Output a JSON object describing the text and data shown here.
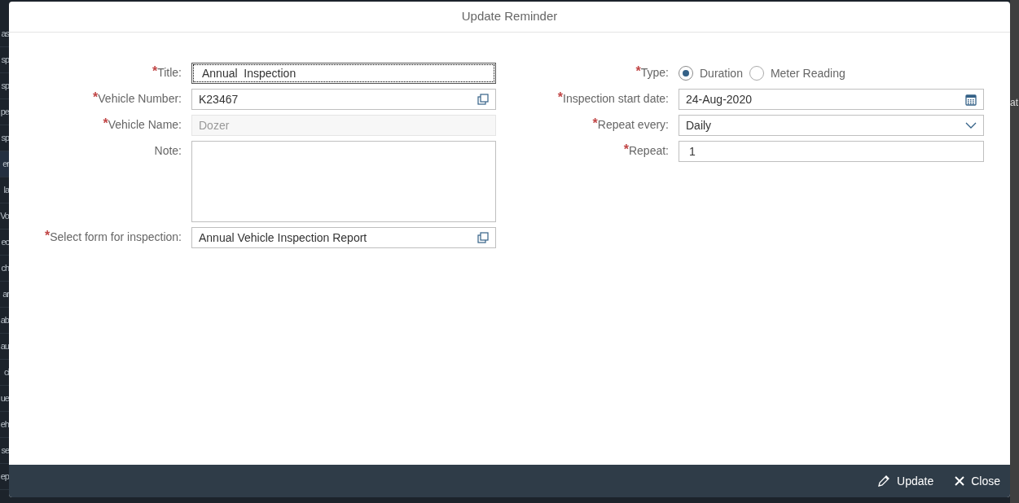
{
  "background": {
    "sidebar_items": [
      {
        "label": "as",
        "selected": false
      },
      {
        "label": "sp",
        "selected": false
      },
      {
        "label": "sp",
        "selected": false
      },
      {
        "label": "pe",
        "selected": false
      },
      {
        "label": "sp",
        "selected": false
      },
      {
        "label": "er",
        "selected": true
      },
      {
        "label": "la",
        "selected": false
      },
      {
        "label": "Vo",
        "selected": false
      },
      {
        "label": "ec",
        "selected": false
      },
      {
        "label": "ch",
        "selected": false
      },
      {
        "label": "ar",
        "selected": false
      },
      {
        "label": "ab",
        "selected": false
      },
      {
        "label": "au",
        "selected": false
      },
      {
        "label": "ci",
        "selected": false
      },
      {
        "label": "ue",
        "selected": false
      },
      {
        "label": "eh",
        "selected": false
      },
      {
        "label": "se",
        "selected": false
      },
      {
        "label": "ep",
        "selected": false
      }
    ],
    "right_fragment": "at"
  },
  "dialog": {
    "title": "Update Reminder",
    "left_fields": [
      {
        "kind": "text",
        "required_mark": "*",
        "label": "Title:",
        "value": "Annual  Inspection",
        "focused": true
      },
      {
        "kind": "value_help",
        "required_mark": "*",
        "label": "Vehicle Number:",
        "value": "K23467"
      },
      {
        "kind": "disabled",
        "required_mark": "*",
        "label": "Vehicle Name:",
        "value": "Dozer"
      },
      {
        "kind": "textarea",
        "label": "Note:"
      },
      {
        "kind": "value_help",
        "required_mark": "*",
        "label": "Select form for inspection:",
        "value": "Annual Vehicle Inspection Report"
      }
    ],
    "right_fields": [
      {
        "kind": "radio",
        "required_mark": "*",
        "label": "Type:",
        "options": [
          {
            "label": "Duration",
            "selected": true
          },
          {
            "label": "Meter Reading",
            "selected": false
          }
        ]
      },
      {
        "kind": "date",
        "required_mark": "*",
        "label": "Inspection start date:",
        "value": "24-Aug-2020"
      },
      {
        "kind": "select",
        "required_mark": "*",
        "label": "Repeat every:",
        "value": "Daily"
      },
      {
        "kind": "text",
        "required_mark": "*",
        "label": "Repeat:",
        "value": "1",
        "focused": false
      }
    ],
    "footer_buttons": [
      {
        "kind": "edit",
        "label": "Update"
      },
      {
        "kind": "close",
        "label": "Close"
      }
    ]
  }
}
